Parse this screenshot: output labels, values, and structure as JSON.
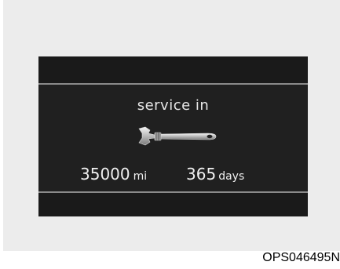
{
  "display": {
    "title": "service in",
    "mileage_value": "35000",
    "mileage_unit": "mi",
    "days_value": "365",
    "days_unit": "days",
    "icon": "wrench-icon"
  },
  "caption": {
    "code": "OPS046495N"
  },
  "colors": {
    "page": "#ffffff",
    "frame": "#ececec",
    "display_bg": "#202020",
    "band": "#1a1a1a",
    "text": "#f0f0f0"
  }
}
